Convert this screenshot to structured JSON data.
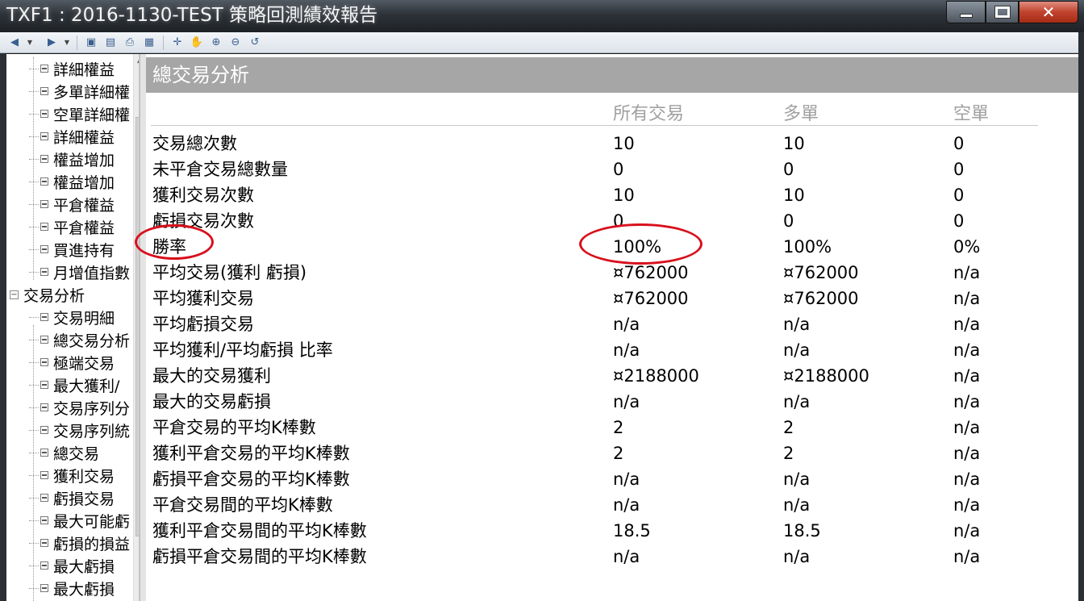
{
  "window": {
    "title": "TXF1 : 2016-1130-TEST 策略回測績效報告"
  },
  "toolbar": {
    "icons": [
      "back-icon",
      "forward-icon",
      "save-icon",
      "preview-icon",
      "print-icon",
      "grid-icon",
      "crosshair-icon",
      "hand-icon",
      "zoom-in-icon",
      "zoom-out-icon",
      "reset-zoom-icon"
    ]
  },
  "tree": {
    "items": [
      {
        "label": "詳細權益",
        "level": 2
      },
      {
        "label": "多單詳細權",
        "level": 2
      },
      {
        "label": "空單詳細權",
        "level": 2
      },
      {
        "label": "詳細權益",
        "level": 2
      },
      {
        "label": "權益增加",
        "level": 2
      },
      {
        "label": "權益增加",
        "level": 2
      },
      {
        "label": "平倉權益",
        "level": 2
      },
      {
        "label": "平倉權益",
        "level": 2
      },
      {
        "label": "買進持有",
        "level": 2
      },
      {
        "label": "月增值指數",
        "level": 2
      },
      {
        "label": "交易分析",
        "level": 1
      },
      {
        "label": "交易明細",
        "level": 2
      },
      {
        "label": "總交易分析",
        "level": 2
      },
      {
        "label": "極端交易",
        "level": 2
      },
      {
        "label": "最大獲利/",
        "level": 2
      },
      {
        "label": "交易序列分",
        "level": 2
      },
      {
        "label": "交易序列統",
        "level": 2
      },
      {
        "label": "總交易",
        "level": 2
      },
      {
        "label": "獲利交易",
        "level": 2
      },
      {
        "label": "虧損交易",
        "level": 2
      },
      {
        "label": "最大可能虧",
        "level": 2
      },
      {
        "label": "虧損的損益",
        "level": 2
      },
      {
        "label": "最大虧損",
        "level": 2
      },
      {
        "label": "最大虧損",
        "level": 2
      }
    ]
  },
  "report": {
    "section_title": "總交易分析",
    "columns": [
      "所有交易",
      "多單",
      "空單"
    ],
    "rows": [
      {
        "label": "交易總次數",
        "all": "10",
        "long": "10",
        "short": "0"
      },
      {
        "label": "未平倉交易總數量",
        "all": "0",
        "long": "0",
        "short": "0"
      },
      {
        "label": "獲利交易次數",
        "all": "10",
        "long": "10",
        "short": "0"
      },
      {
        "label": "虧損交易次數",
        "all": "0",
        "long": "0",
        "short": "0"
      },
      {
        "label": "勝率",
        "all": "100%",
        "long": "100%",
        "short": "0%"
      },
      {
        "label": "平均交易(獲利  虧損)",
        "all": "¤762000",
        "long": "¤762000",
        "short": "n/a"
      },
      {
        "label": "平均獲利交易",
        "all": "¤762000",
        "long": "¤762000",
        "short": "n/a"
      },
      {
        "label": "平均虧損交易",
        "all": "n/a",
        "long": "n/a",
        "short": "n/a"
      },
      {
        "label": "平均獲利/平均虧損  比率",
        "all": "n/a",
        "long": "n/a",
        "short": "n/a"
      },
      {
        "label": "最大的交易獲利",
        "all": "¤2188000",
        "long": "¤2188000",
        "short": "n/a"
      },
      {
        "label": "最大的交易虧損",
        "all": "n/a",
        "long": "n/a",
        "short": "n/a"
      },
      {
        "label": "平倉交易的平均K棒數",
        "all": "2",
        "long": "2",
        "short": "n/a"
      },
      {
        "label": "獲利平倉交易的平均K棒數",
        "all": "2",
        "long": "2",
        "short": "n/a"
      },
      {
        "label": "虧損平倉交易的平均K棒數",
        "all": "n/a",
        "long": "n/a",
        "short": "n/a"
      },
      {
        "label": "平倉交易間的平均K棒數",
        "all": "n/a",
        "long": "n/a",
        "short": "n/a"
      },
      {
        "label": "獲利平倉交易間的平均K棒數",
        "all": "18.5",
        "long": "18.5",
        "short": "n/a"
      },
      {
        "label": "虧損平倉交易間的平均K棒數",
        "all": "n/a",
        "long": "n/a",
        "short": "n/a"
      }
    ]
  },
  "colors": {
    "annotation": "#d8101d",
    "header_bg": "#a6a6a6"
  }
}
